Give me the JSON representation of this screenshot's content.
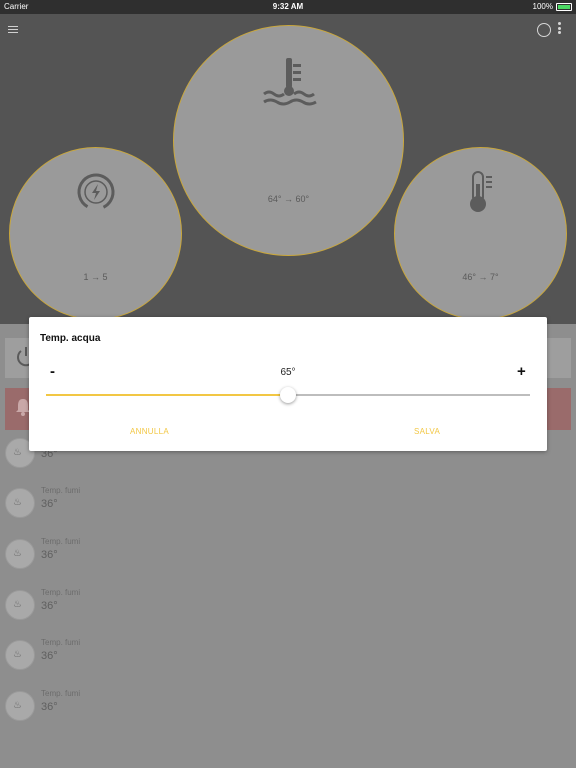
{
  "status_bar": {
    "carrier": "Carrier",
    "time": "9:32 AM",
    "battery": "100%",
    "battery_level": 1.0
  },
  "gauges": {
    "left": {
      "icon": "power-gauge-icon",
      "range": "1 → 5"
    },
    "middle": {
      "icon": "water-temperature-icon",
      "range": "64° → 60°"
    },
    "right": {
      "icon": "thermometer-icon",
      "range": "46° → 7°"
    }
  },
  "list_items": [
    {
      "label": "",
      "value": "36°"
    },
    {
      "label": "Temp. fumi",
      "value": "36°"
    },
    {
      "label": "Temp. fumi",
      "value": "36°"
    },
    {
      "label": "Temp. fumi",
      "value": "36°"
    },
    {
      "label": "Temp. fumi",
      "value": "36°"
    },
    {
      "label": "Temp. fumi",
      "value": "36°"
    }
  ],
  "dialog": {
    "title": "Temp. acqua",
    "minus": "-",
    "plus": "+",
    "value": "65°",
    "slider_fraction": 0.5,
    "cancel_label": "ANNULLA",
    "save_label": "SALVA"
  },
  "colors": {
    "accent": "#f2c744",
    "header_bg": "#545454",
    "alarm": "#9a6b6b"
  }
}
